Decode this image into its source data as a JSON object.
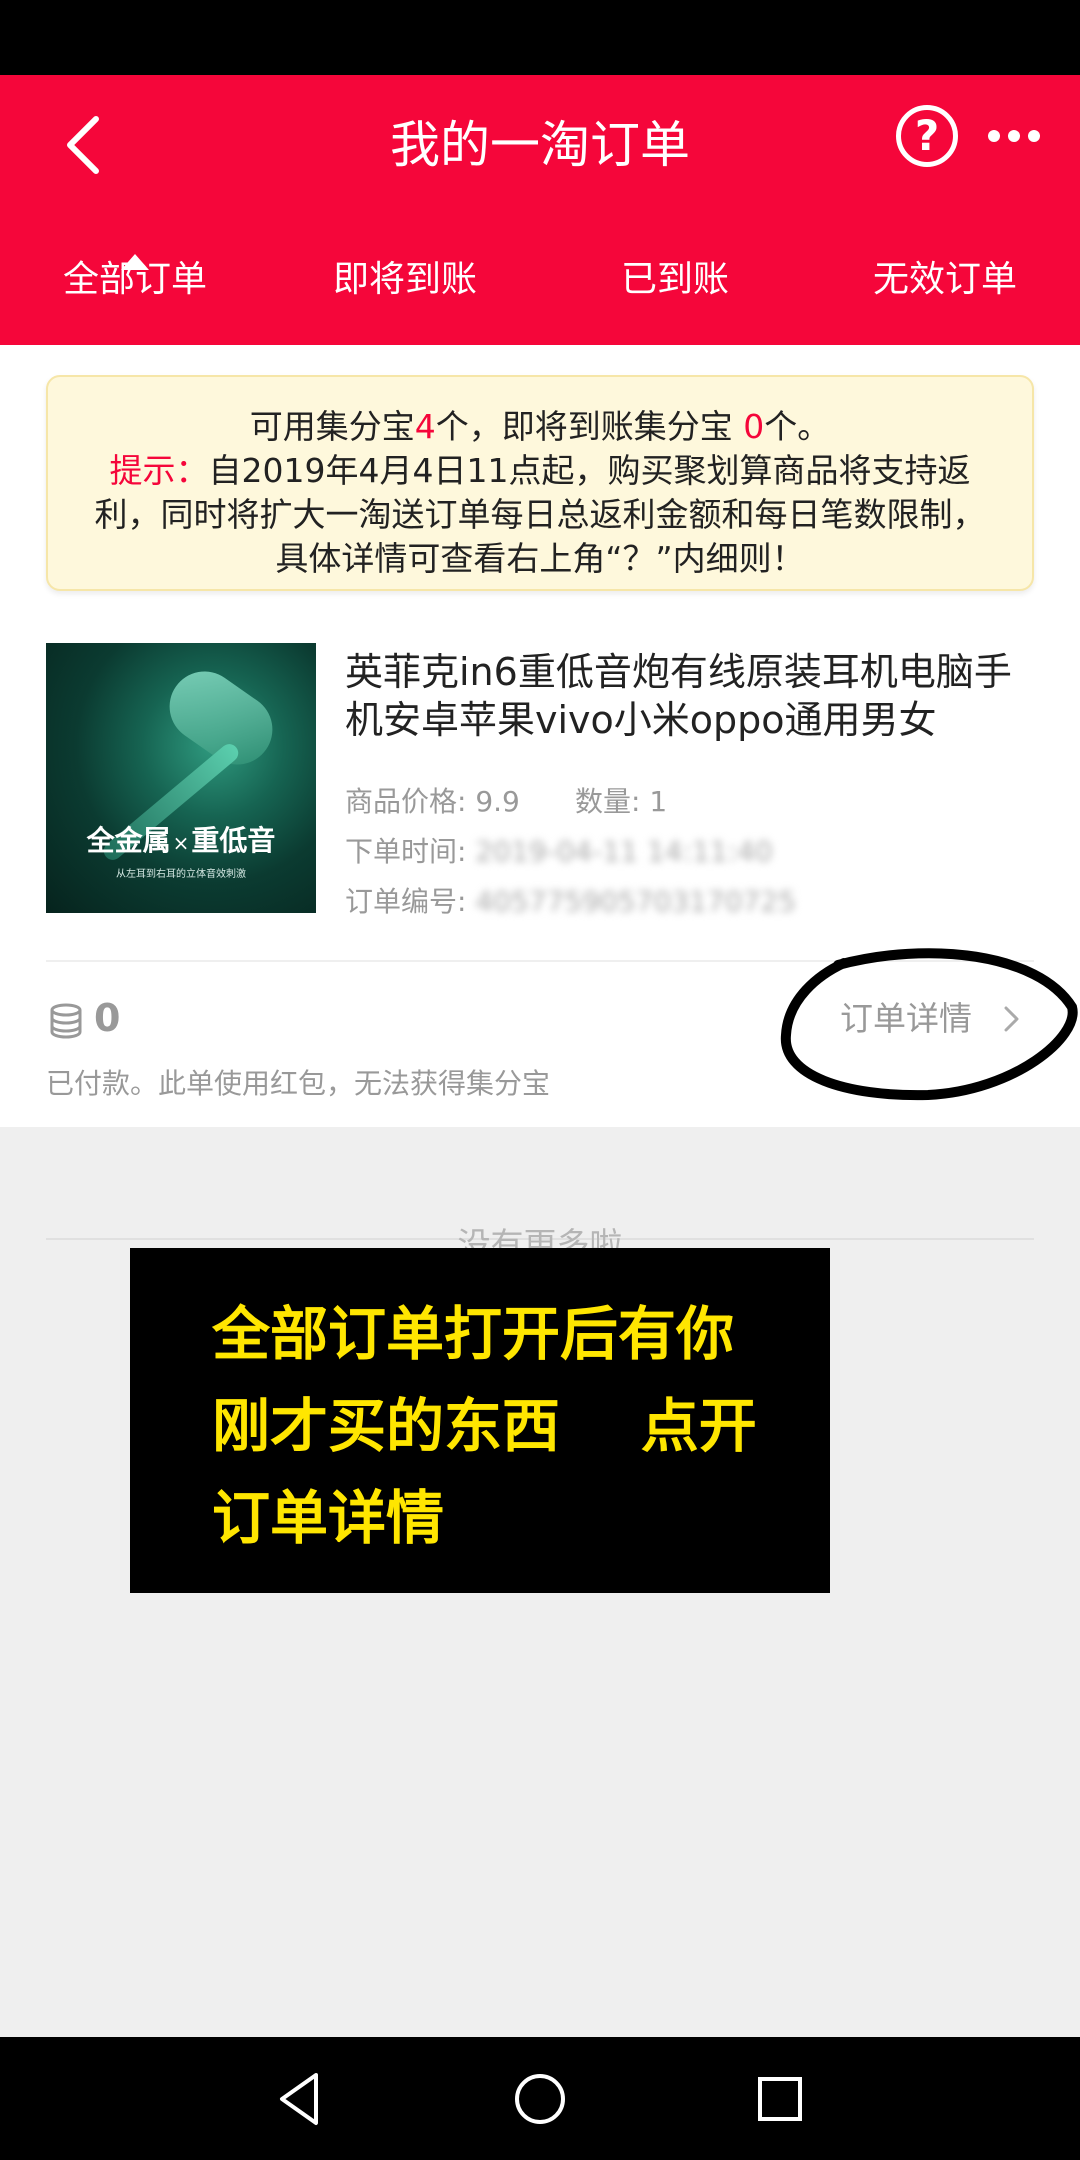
{
  "header": {
    "title": "我的一淘订单",
    "back_icon": "chevron-left-icon",
    "help_label": "?",
    "more_icon": "more-dots-icon"
  },
  "tabs": [
    {
      "label": "全部订单",
      "active": true
    },
    {
      "label": "即将到账",
      "active": false
    },
    {
      "label": "已到账",
      "active": false
    },
    {
      "label": "无效订单",
      "active": false
    }
  ],
  "notice": {
    "line1_pre": "可用集分宝",
    "available_count": "4",
    "line1_mid": "个，即将到账集分宝 ",
    "pending_count": "0",
    "line1_post": "个。",
    "tip_label": "提示：",
    "tip_text": "自2019年4月4日11点起，购买聚划算商品将支持返利，同时将扩大一淘送订单每日总返利金额和每日笔数限制，具体详情可查看右上角“？”内细则！"
  },
  "order": {
    "product_title": "英菲克in6重低音炮有线原装耳机电脑手机安卓苹果vivo小米oppo通用男女",
    "image_main_a": "全金属",
    "image_main_x": "×",
    "image_main_b": "重低音",
    "image_sub": "从左耳到右耳的立体音效刺激",
    "price_label": "商品价格: ",
    "price": "9.9",
    "quantity_label": "数量: ",
    "quantity": "1",
    "time_label": "下单时间: ",
    "time_value": "2019-04-11 14:11:40",
    "order_no_label": "订单编号: ",
    "order_no_value": "405775905703170725",
    "coin_icon": "coin-stack-icon",
    "coin_value": "0",
    "payment_note": "已付款。此单使用红包，无法获得集分宝",
    "detail_label": "订单详情",
    "detail_icon": "chevron-right-icon"
  },
  "list_end": "没有更多啦",
  "overlay": {
    "line1": "全部订单打开后有你",
    "line2": "刚才买的东西    点开",
    "line3": "订单详情"
  },
  "nav": {
    "back_icon": "nav-back-icon",
    "home_icon": "nav-home-icon",
    "recent_icon": "nav-recent-icon"
  },
  "colors": {
    "brand_red": "#f5063a",
    "notice_bg": "#fef8dc",
    "overlay_text": "#ffe600"
  }
}
